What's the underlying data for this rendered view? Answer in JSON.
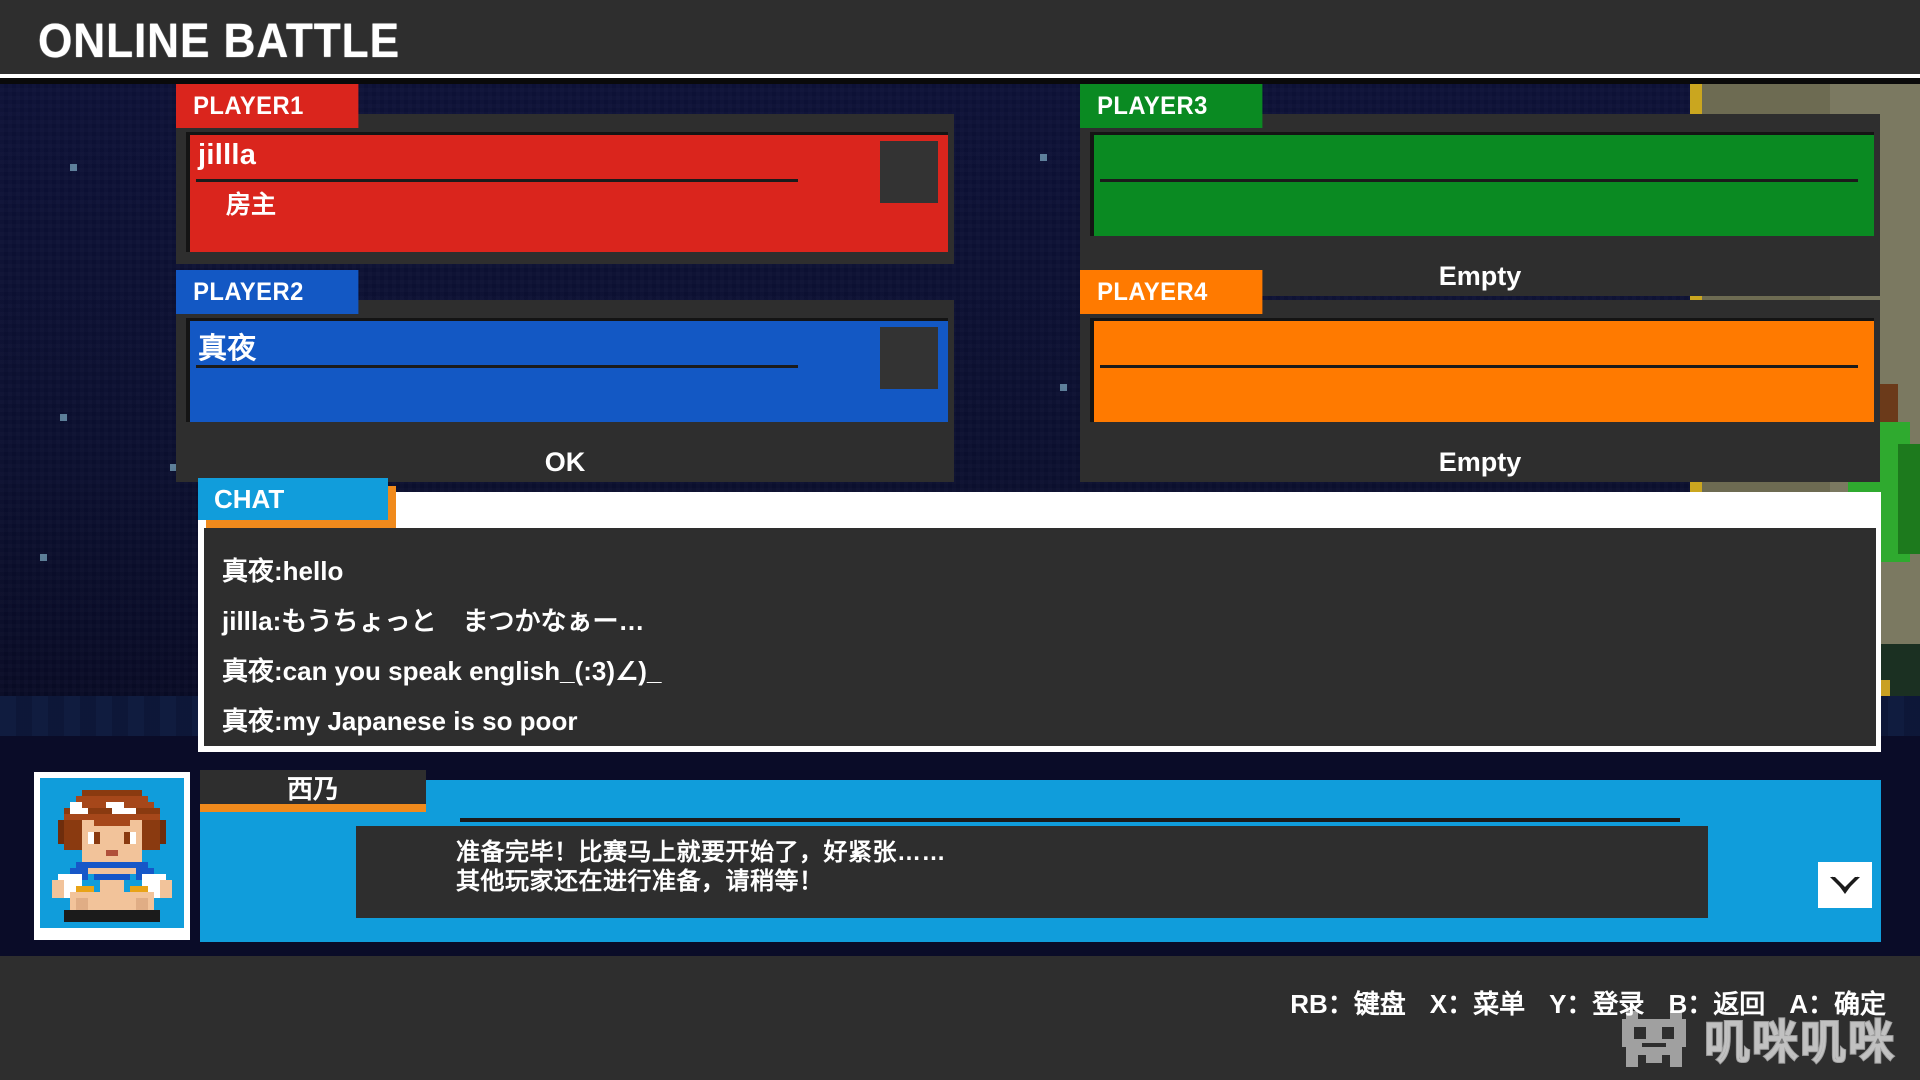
{
  "header": {
    "title": "ONLINE BATTLE"
  },
  "players": [
    {
      "tab_label": "PLAYER1",
      "color": "#da251d",
      "name": "jillla",
      "subtitle": "房主",
      "status": "",
      "has_avatar": true
    },
    {
      "tab_label": "PLAYER2",
      "color": "#1358c4",
      "name": "真夜",
      "subtitle": "",
      "status": "OK",
      "has_avatar": true
    },
    {
      "tab_label": "PLAYER3",
      "color": "#0a8a22",
      "name": "",
      "subtitle": "",
      "status": "Empty",
      "has_avatar": false
    },
    {
      "tab_label": "PLAYER4",
      "color": "#ff7a00",
      "name": "",
      "subtitle": "",
      "status": "Empty",
      "has_avatar": false
    }
  ],
  "chat": {
    "tab_label": "CHAT",
    "tab_color": "#119ddb",
    "tab_shadow_color": "#f08a1c",
    "messages": [
      "真夜:hello",
      "jillla:もうちょっと　まつかなぁー…",
      "真夜:can you speak english_(:3)∠)_",
      "真夜:my Japanese is so poor"
    ]
  },
  "dialogue": {
    "speaker": "西乃",
    "accent_color": "#f08a1c",
    "panel_color": "#109ddb",
    "lines": [
      "准备完毕！比赛马上就要开始了，好紧张……",
      "其他玩家还在进行准备，请稍等！"
    ],
    "next_icon": "chevron-down-icon"
  },
  "footer": {
    "hints": [
      "RB：键盘",
      "X：菜单",
      "Y：登录",
      "B：返回",
      "A：确定"
    ],
    "watermark_text": "叽咪叽咪",
    "watermark_icon": "pixel-invader-icon"
  }
}
